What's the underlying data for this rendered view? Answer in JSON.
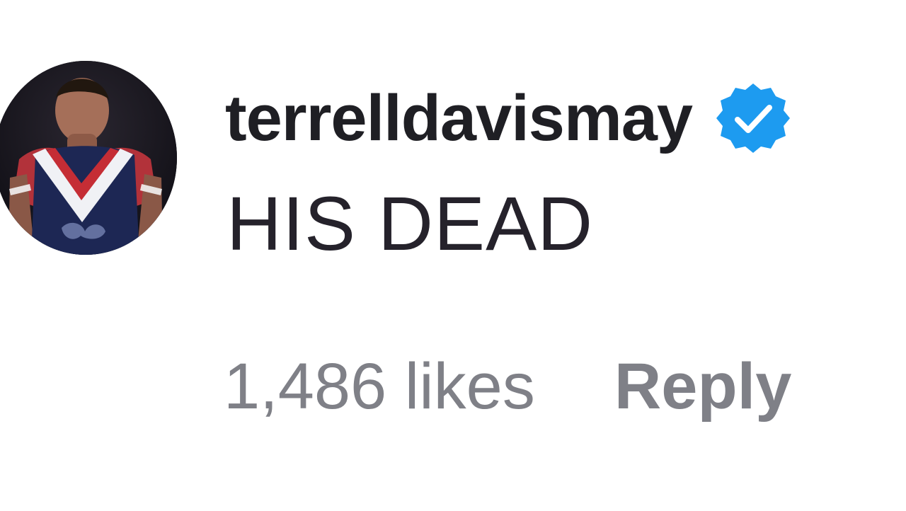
{
  "comment": {
    "avatar_icon": "profile-photo",
    "username": "terrelldavismay",
    "verified_icon": "verified-badge-icon",
    "verified_color": "#1d9bf0",
    "text": "HIS DEAD",
    "likes_label": "1,486 likes",
    "reply_label": "Reply"
  }
}
